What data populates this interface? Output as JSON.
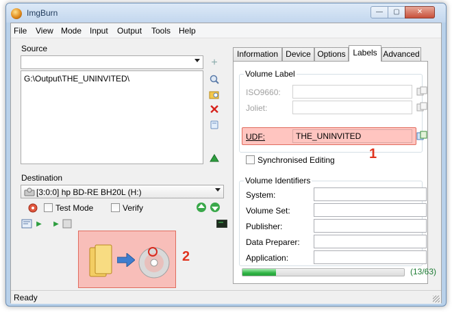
{
  "window": {
    "title": "ImgBurn",
    "min": "—",
    "max": "▢",
    "close": "✕"
  },
  "menu": [
    "File",
    "View",
    "Mode",
    "Input",
    "Output",
    "Tools",
    "Help"
  ],
  "source": {
    "label": "Source",
    "combo_value": "",
    "path": "G:\\Output\\THE_UNINVITED\\"
  },
  "destination": {
    "label": "Destination",
    "drive": "[3:0:0] hp BD-RE  BH20L (H:)",
    "test_mode_label": "Test Mode",
    "verify_label": "Verify"
  },
  "tabs": [
    "Information",
    "Device",
    "Options",
    "Labels",
    "Advanced"
  ],
  "active_tab": "Labels",
  "volume_label": {
    "legend": "Volume Label",
    "iso_label": "ISO9660:",
    "joliet_label": "Joliet:",
    "udf_label": "UDF:",
    "udf_value": "THE_UNINVITED",
    "sync_label": "Synchronised Editing"
  },
  "volume_identifiers": {
    "legend": "Volume Identifiers",
    "fields": [
      "System:",
      "Volume Set:",
      "Publisher:",
      "Data Preparer:",
      "Application:"
    ]
  },
  "progress": {
    "value": 13,
    "total": 63,
    "text": "(13/63)"
  },
  "annotations": {
    "one": "1",
    "two": "2"
  },
  "status": "Ready",
  "colors": {
    "highlight": "#ff968c",
    "annotation": "#e0331e",
    "progress": "#2fb344"
  }
}
